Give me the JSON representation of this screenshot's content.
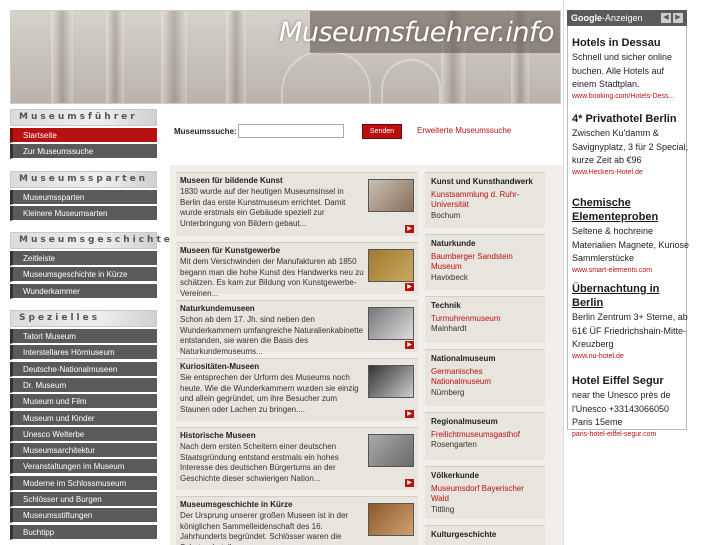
{
  "site_title": "Museumsfuehrer.info",
  "nav": [
    {
      "header": "Museumsführer",
      "items": [
        {
          "label": "Startseite",
          "active": true
        },
        {
          "label": "Zur Museumssuche"
        }
      ]
    },
    {
      "header": "Museumssparten",
      "items": [
        {
          "label": "Museumssparten"
        },
        {
          "label": "Kleinere Museumsarten"
        }
      ]
    },
    {
      "header": "Museumsgeschichte",
      "items": [
        {
          "label": "Zeitleiste"
        },
        {
          "label": "Museumsgeschichte in Kürze"
        },
        {
          "label": "Wunderkammer"
        }
      ]
    },
    {
      "header": "Spezielles",
      "items": [
        {
          "label": "Tatort Museum"
        },
        {
          "label": "Interstellares Hörmuseum"
        },
        {
          "label": "Deutsche-Nationalmuseen"
        },
        {
          "label": "Dr. Museum"
        },
        {
          "label": "Museum und Film"
        },
        {
          "label": "Museum und Kinder"
        },
        {
          "label": "Unesco Welterbe"
        },
        {
          "label": "Museumsarchitektur"
        },
        {
          "label": "Veranstaltungen im Museum"
        },
        {
          "label": "Moderne im Schlossmuseum"
        },
        {
          "label": "Schlösser und Burgen"
        },
        {
          "label": "Museumsstiftungen"
        },
        {
          "label": "Buchtipp"
        }
      ]
    }
  ],
  "search": {
    "label": "Museumssuche:",
    "button": "Senden",
    "advanced": "Erweiterte Museumssuche"
  },
  "cards": [
    {
      "title": "Museen für bildende Kunst",
      "text": "1830 wurde auf der heutigen Museumsinsel in Berlin das erste Kunstmuseum errichtet. Damit wurde erstmals ein Gebäude speziell zur Unterbringung von Bildern gebaut..."
    },
    {
      "title": "Museen für Kunstgewerbe",
      "text": "Mit dem Verschwinden der Manufakturen ab 1850 begann man die hohe Kunst des Handwerks neu zu schätzen. Es kam zur Bildung von Kunstgewerbe-Vereinen..."
    },
    {
      "title": "Naturkundemuseen",
      "text": "Schon ab dem 17. Jh. sind neben den Wunderkammern umfangreiche Naturalienkabinette entstanden, sie waren die Basis des Naturkundemuseums..."
    },
    {
      "title": "Kuriositäten-Museen",
      "text": "Sie entsprechen der Urform des Museums noch heute. Wie die Wunderkammern wurden sie einzig und allein gegründet, um ihre Besucher zum Staunen oder Lachen zu bringen...."
    },
    {
      "title": "Historische Museen",
      "text": "Nach dem ersten Scheitern einer deutschen Staatsgründung entstand erstmals ein hohes Interesse des deutschen Bürgertums an der Geschichte dieser schwierigen Nation..."
    },
    {
      "title": "Museumsgeschichte in Kürze",
      "text": "Der Ursprung unserer großen Museen ist in der königlichen Sammelleidenschaft des 16. Jahrhunderts begründet. Schlösser waren die Schatzschatullen"
    }
  ],
  "side": [
    {
      "h": "Kunst und Kunsthandwerk",
      "l": "Kunstsammlung d. Ruhr-Universität",
      "p": "Bochum"
    },
    {
      "h": "Naturkunde",
      "l": "Baumberger Sandstein Museum",
      "p": "Havixbeck"
    },
    {
      "h": "Technik",
      "l": "Turmuhrenmuseum",
      "p": "Mainhardt"
    },
    {
      "h": "Nationalmuseum",
      "l": "Germanisches Nationalmuseum",
      "p": "Nürnberg"
    },
    {
      "h": "Regionalmuseum",
      "l": "Freilichtmuseumsgasthof",
      "p": "Rosengarten"
    },
    {
      "h": "Völkerkunde",
      "l": "Museumsdorf Bayerischer Wald",
      "p": "Tittling"
    },
    {
      "h": "Kulturgeschichte",
      "l": "",
      "p": ""
    }
  ],
  "ads_label": "Anzeigen",
  "ads_brand": "Google",
  "ads": [
    {
      "t": "Hotels in Dessau",
      "d": "Schnell und sicher online buchen. Alle Hotels auf einem Stadtplan.",
      "u": "www.booking.com/Hotels-Dess..."
    },
    {
      "t": "4* Privathotel Berlin",
      "d": "Zwischen Ku'damm & Savignyplatz, 3 für 2 Special, kurze Zeit ab €96",
      "u": "www.Heckers-Hotel.de"
    },
    {
      "t": "Chemische Elementeproben",
      "d": "Seltene & hochreine Materialien Magnete, Kuriose Sammlerstücke",
      "u": "www.smart-elements.com"
    },
    {
      "t": "Übernachtung in Berlin",
      "d": "Berlin Zentrum 3+ Sterne, ab 61€ ÜF Friedrichshain-Mitte-Kreuzberg",
      "u": "www.nu-hotel.de"
    },
    {
      "t": "Hotel Eiffel Segur",
      "d": "near the Unesco près de l'Unesco +33143066050 Paris 15eme",
      "u": "paris-hotel-eiffel-segur.com"
    }
  ]
}
